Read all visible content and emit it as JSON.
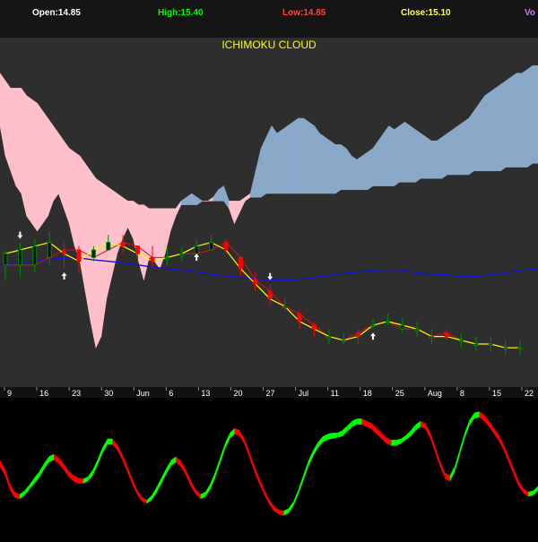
{
  "header": {
    "open_label": "Open:14.85",
    "high_label": "High:15.40",
    "low_label": "Low:14.85",
    "close_label": "Close:15.10",
    "vol_label": "Vo"
  },
  "colors": {
    "header_bg": "#151515",
    "panel_bg": "#2e2e2e",
    "osc_bg": "#000000",
    "bull_candle": "#008a00",
    "bear_candle": "#ff0000",
    "cloud_fill": "#ffc0cb",
    "cloud_bull_fill": "#8aa9c9",
    "ma_long": "#d2a070",
    "kijun": "#1414d8",
    "tenkan": "#e01010",
    "signal_line": "#ffff00",
    "chikou": "#3a9e3a",
    "trendline": "#ffffff",
    "osc_up": "#00ff00",
    "osc_down": "#ff0000",
    "open_color": "#ffffff",
    "high_color": "#00ff00",
    "low_color": "#ff4040",
    "close_color": "#ffff66",
    "vol_color": "#d070ff",
    "title_color": "#ffff00"
  },
  "chart_data": [
    {
      "type": "candlestick",
      "title": "ICHIMOKU CLOUD",
      "x_labels": [
        "9",
        "16",
        "23",
        "30",
        "Jun",
        "6",
        "13",
        "20",
        "27",
        "Jul",
        "11",
        "18",
        "25",
        "Aug",
        "8",
        "15",
        "22"
      ],
      "series": [
        {
          "values": [
            16.9,
            16.5,
            16.3,
            16.1,
            16.0,
            15.7,
            15.6,
            15.5,
            15.6,
            15.7,
            15.9,
            16.0,
            15.8,
            15.6,
            15.3,
            15.1,
            14.7,
            14.3,
            13.95,
            14.1,
            14.6,
            14.9,
            15.2,
            15.4,
            15.55,
            15.4,
            15.1,
            14.85,
            15.15,
            15.1,
            15.0,
            15.2,
            15.5,
            15.7,
            15.9,
            15.95,
            16.0,
            15.95,
            15.9,
            15.9,
            15.95,
            16.05,
            16.1,
            15.8,
            15.6,
            15.75,
            15.9,
            16.0,
            16.3,
            16.6,
            16.75,
            16.9,
            16.8,
            16.85,
            16.9,
            16.95,
            17.0,
            17.0,
            16.95,
            16.9,
            16.8,
            16.75,
            16.7,
            16.65,
            16.65,
            16.6,
            16.5,
            16.45,
            16.5,
            16.55,
            16.6,
            16.7,
            16.8,
            16.9,
            16.85,
            16.9,
            16.95,
            16.9,
            16.85,
            16.8,
            16.75,
            16.7,
            16.7,
            16.75,
            16.8,
            16.85,
            16.9,
            16.95,
            17.0,
            17.1,
            17.2,
            17.3,
            17.35,
            17.4,
            17.45,
            17.5,
            17.55,
            17.6,
            17.6,
            17.65,
            17.7,
            17.7
          ]
        },
        {
          "values": [
            17.6,
            17.5,
            17.4,
            17.4,
            17.4,
            17.3,
            17.25,
            17.2,
            17.1,
            17.0,
            16.9,
            16.8,
            16.7,
            16.6,
            16.55,
            16.5,
            16.4,
            16.3,
            16.2,
            16.15,
            16.1,
            16.05,
            16.0,
            15.95,
            15.9,
            15.9,
            15.85,
            15.85,
            15.8,
            15.8,
            15.8,
            15.8,
            15.8,
            15.8,
            15.85,
            15.85,
            15.85,
            15.85,
            15.9,
            15.9,
            15.9,
            15.9,
            15.9,
            15.9,
            15.9,
            15.9,
            15.95,
            15.95,
            15.95,
            15.95,
            16.0,
            16.0,
            16.0,
            16.0,
            16.0,
            16.0,
            16.0,
            16.0,
            16.0,
            16.0,
            16.0,
            16.0,
            16.0,
            16.0,
            16.05,
            16.05,
            16.05,
            16.05,
            16.05,
            16.05,
            16.1,
            16.1,
            16.1,
            16.1,
            16.1,
            16.15,
            16.15,
            16.15,
            16.15,
            16.2,
            16.2,
            16.2,
            16.2,
            16.2,
            16.25,
            16.25,
            16.25,
            16.25,
            16.25,
            16.3,
            16.3,
            16.3,
            16.3,
            16.3,
            16.3,
            16.35,
            16.35,
            16.35,
            16.35,
            16.35,
            16.4,
            16.4
          ]
        },
        {
          "values": [
            15.05,
            15.08,
            15.1,
            15.12,
            15.14,
            15.15,
            15.12,
            15.1,
            15.08,
            15.05,
            15.02,
            15.0,
            14.98,
            14.95,
            14.92,
            14.9,
            14.88,
            14.86,
            14.85,
            14.85,
            14.87,
            14.9,
            14.93,
            14.95,
            14.97,
            14.98,
            14.98,
            14.95,
            14.93,
            14.92,
            14.9,
            14.9,
            14.92,
            14.95,
            14.98,
            15.0
          ]
        },
        {
          "values": [
            15.05,
            15.05,
            15.05,
            15.15,
            15.25,
            15.25,
            15.15,
            15.25,
            15.35,
            15.3,
            15.15,
            15.15,
            15.2,
            15.2,
            15.25,
            15.35,
            15.15,
            14.85,
            14.7,
            14.5,
            14.4,
            14.25,
            14.1,
            14.05,
            14.15,
            14.25,
            14.3,
            14.2,
            14.2,
            14.1,
            14.15,
            14.05,
            14.0,
            14.0,
            13.95,
            13.95
          ]
        },
        {
          "values": [
            15.2,
            15.25,
            15.3,
            15.35,
            15.2,
            15.1,
            15.25,
            15.35,
            15.3,
            15.2,
            15.1,
            15.15,
            15.2,
            15.3,
            15.35,
            15.25,
            15.0,
            14.8,
            14.6,
            14.5,
            14.3,
            14.2,
            14.1,
            14.05,
            14.1,
            14.25,
            14.3,
            14.25,
            14.2,
            14.1,
            14.1,
            14.05,
            14.0,
            14.0,
            13.95,
            13.95
          ]
        },
        {
          "values": [
            14.85,
            14.9,
            14.95,
            15.05,
            15.0,
            14.95,
            15.1,
            15.25,
            15.2,
            15.1,
            15.0,
            15.05,
            15.1,
            15.25,
            15.3,
            15.2,
            14.9,
            14.7,
            14.5,
            14.45,
            14.2,
            14.1,
            14.0,
            14.0,
            14.0,
            14.2,
            14.25,
            14.15,
            14.1,
            14.0,
            14.05,
            13.95,
            13.9,
            13.9,
            13.85,
            13.85
          ]
        },
        {
          "values": [
            15.25,
            15.35,
            15.4,
            15.5,
            15.35,
            15.3,
            15.3,
            15.45,
            15.45,
            15.3,
            15.3,
            15.3,
            15.3,
            15.4,
            15.45,
            15.4,
            15.15,
            14.95,
            14.8,
            14.6,
            14.45,
            14.3,
            14.2,
            14.15,
            14.2,
            14.35,
            14.4,
            14.35,
            14.3,
            14.2,
            14.2,
            14.15,
            14.1,
            14.1,
            14.05,
            14.05
          ]
        }
      ]
    },
    {
      "type": "area",
      "x_range": [
        0,
        100
      ],
      "series": [
        {
          "values": [
            55,
            48,
            35,
            28,
            26,
            29,
            34,
            40,
            45,
            52,
            58,
            60,
            57,
            52,
            46,
            42,
            40,
            39,
            41,
            47,
            56,
            66,
            73,
            73,
            68,
            60,
            50,
            40,
            30,
            24,
            21,
            25,
            32,
            40,
            48,
            55,
            58,
            54,
            47,
            38,
            30,
            26,
            28,
            35,
            45,
            57,
            69,
            78,
            82,
            80,
            73,
            62,
            50,
            40,
            30,
            22,
            16,
            13,
            12,
            14,
            20,
            30,
            42,
            54,
            63,
            70,
            75,
            77,
            78,
            78,
            80,
            84,
            88,
            90,
            90,
            88,
            86,
            82,
            78,
            74,
            72,
            72,
            73,
            76,
            80,
            85,
            88,
            86,
            78,
            66,
            54,
            44,
            42,
            50,
            64,
            78,
            89,
            95,
            96,
            93,
            88,
            82,
            76,
            68,
            58,
            48,
            38,
            31,
            28,
            29,
            33
          ]
        },
        {
          "values": [
            52,
            45,
            33,
            26,
            25,
            28,
            33,
            38,
            43,
            50,
            56,
            58,
            55,
            50,
            44,
            40,
            38,
            38,
            40,
            45,
            54,
            64,
            71,
            71,
            66,
            58,
            48,
            38,
            29,
            23,
            21,
            24,
            30,
            38,
            46,
            53,
            56,
            52,
            45,
            36,
            29,
            25,
            27,
            33,
            43,
            55,
            67,
            76,
            80,
            78,
            71,
            60,
            48,
            38,
            29,
            21,
            15,
            12,
            11,
            13,
            19,
            29,
            40,
            52,
            61,
            68,
            73,
            75,
            76,
            77,
            78,
            82,
            86,
            88,
            88,
            86,
            84,
            80,
            76,
            72,
            70,
            70,
            72,
            75,
            78,
            83,
            86,
            84,
            76,
            64,
            52,
            42,
            40,
            48,
            62,
            76,
            87,
            93,
            94,
            91,
            86,
            80,
            74,
            66,
            56,
            46,
            36,
            30,
            27,
            28,
            32
          ]
        }
      ]
    }
  ]
}
